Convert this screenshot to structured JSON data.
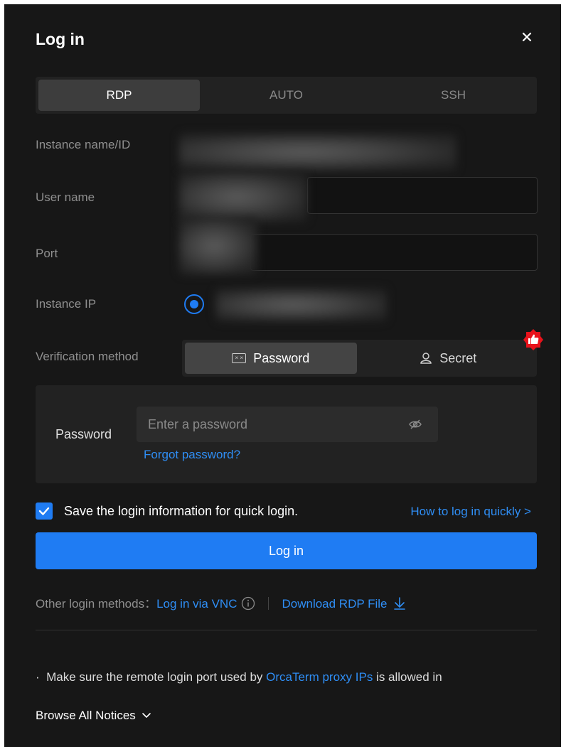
{
  "dialog": {
    "title": "Log in",
    "close_icon": "close-icon"
  },
  "protocol_tabs": [
    {
      "label": "RDP",
      "active": true
    },
    {
      "label": "AUTO",
      "active": false
    },
    {
      "label": "SSH",
      "active": false
    }
  ],
  "fields": {
    "instance_name_label": "Instance name/ID",
    "user_name_label": "User name",
    "port_label": "Port",
    "instance_ip_label": "Instance IP",
    "verification_label": "Verification method"
  },
  "verification": {
    "password_label": "Password",
    "secret_label": "Secret",
    "selected": "Password"
  },
  "password_panel": {
    "label": "Password",
    "placeholder": "Enter a password",
    "forgot": "Forgot password?"
  },
  "save_login": {
    "checked": true,
    "label": "Save the login information for quick login.",
    "howto": "How to log in quickly >"
  },
  "login_button": "Log in",
  "other_methods": {
    "prefix": "Other login methods：",
    "vnc": "Log in via VNC",
    "rdp_file": "Download RDP File"
  },
  "notice": {
    "bullet": "·",
    "text_before": "Make sure the remote login port used by ",
    "link": "OrcaTerm proxy IPs",
    "text_after": " is allowed in",
    "browse": "Browse All Notices"
  },
  "colors": {
    "accent": "#1f7cf3",
    "link": "#2f8ef5",
    "background": "#171717",
    "badge": "#e8121b"
  }
}
